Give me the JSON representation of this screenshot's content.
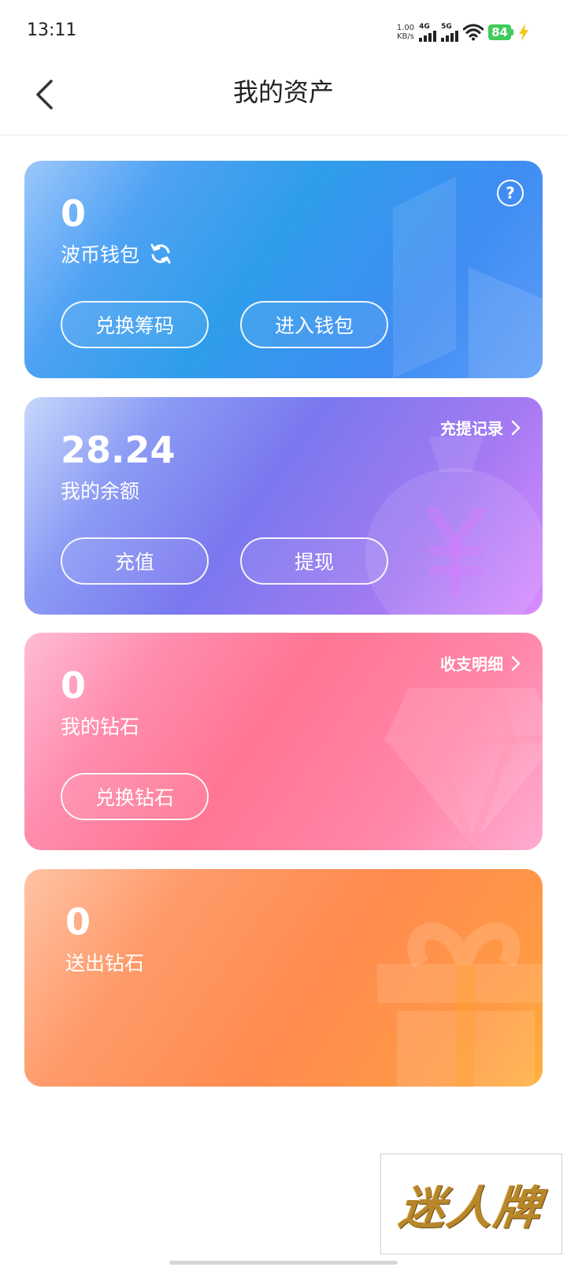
{
  "status_bar": {
    "time": "13:11",
    "net_speed_value": "1.00",
    "net_speed_unit": "KB/s",
    "signal_1_label": "4G",
    "signal_2_label": "5G",
    "battery": "84",
    "icons": [
      "signal-icon",
      "wifi-icon",
      "battery-icon",
      "charging-icon"
    ]
  },
  "header": {
    "title": "我的资产",
    "back_icon": "chevron-left-icon"
  },
  "wallet_card": {
    "amount": "0",
    "label": "波币钱包",
    "refresh_icon": "refresh-icon",
    "help_icon": "help-icon",
    "help_glyph": "?",
    "buttons": [
      "兑换筹码",
      "进入钱包"
    ],
    "colors": {
      "from": "#9cc7fb",
      "to": "#3f8df3"
    }
  },
  "balance_card": {
    "amount": "28.24",
    "label": "我的余额",
    "link": "充提记录",
    "buttons": [
      "充值",
      "提现"
    ],
    "colors": {
      "from": "#c7d8fb",
      "to": "#d98cff"
    }
  },
  "diamond_card": {
    "amount": "0",
    "label": "我的钻石",
    "link": "收支明细",
    "buttons": [
      "兑换钻石"
    ],
    "colors": {
      "from": "#ffbcd6",
      "to": "#ff7693"
    }
  },
  "sent_card": {
    "amount": "0",
    "label": "送出钻石",
    "colors": {
      "from": "#ffc3a6",
      "to": "#ffb03d"
    }
  },
  "brand": {
    "text": "迷人牌"
  }
}
